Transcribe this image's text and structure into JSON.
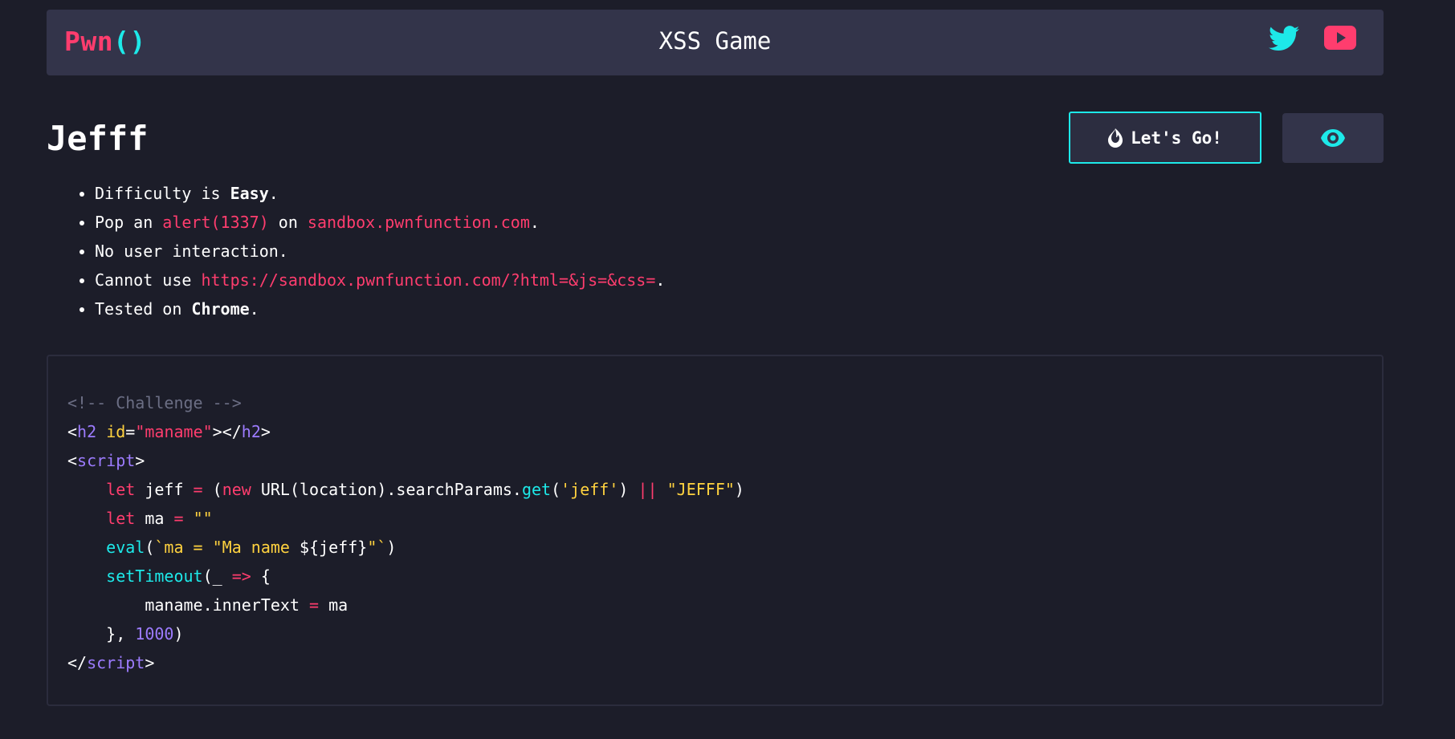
{
  "header": {
    "brand_text": "Pwn",
    "brand_parens": "()",
    "title": "XSS Game",
    "social": [
      {
        "icon": "twitter-icon"
      },
      {
        "icon": "youtube-icon"
      }
    ]
  },
  "challenge": {
    "name": "Jefff",
    "go_button_label": "Let's Go!",
    "go_button_icon": "fire-icon",
    "eye_button_icon": "eye-icon",
    "rules": {
      "r1_a": "Difficulty is ",
      "r1_b": "Easy",
      "r1_c": ".",
      "r2_a": "Pop an ",
      "r2_b": "alert(1337)",
      "r2_c": " on ",
      "r2_d": "sandbox.pwnfunction.com",
      "r2_e": ".",
      "r3": "No user interaction.",
      "r4_a": "Cannot use ",
      "r4_b": "https://sandbox.pwnfunction.com/?html=&js=&css=",
      "r4_c": ".",
      "r5_a": "Tested on ",
      "r5_b": "Chrome",
      "r5_c": "."
    }
  },
  "code": {
    "l1": "<!-- Challenge -->",
    "l2_tag": "h2",
    "l2_attr": "id",
    "l2_val": "\"maname\"",
    "l3_tag": "script",
    "l4_kw": "let",
    "l4_var": " jeff ",
    "l4_op": "=",
    "l4_new": "new",
    "l4_mid": " URL(location).searchParams.",
    "l4_get": "get",
    "l4_arg": "'jeff'",
    "l4_or": "||",
    "l4_def": "\"JEFFF\"",
    "l5_kw": "let",
    "l5_var": " ma ",
    "l5_op": "=",
    "l5_str": "\"\"",
    "l6_fn": "eval",
    "l6_s1": "`ma = \"Ma name ",
    "l6_tpl": "${jeff}",
    "l6_s2": "\"`",
    "l7_fn": "setTimeout",
    "l7_arg": "(_ ",
    "l7_arrow": "=>",
    "l7_end": " {",
    "l8_a": "maname.innerText ",
    "l8_op": "=",
    "l8_b": " ma",
    "l9_a": "}, ",
    "l9_num": "1000",
    "l9_b": ")",
    "l10_tag": "script"
  },
  "colors": {
    "accent_pink": "#ff3d6e",
    "accent_cyan": "#1de9e9",
    "background": "#1c1d29",
    "panel": "#33344a"
  }
}
